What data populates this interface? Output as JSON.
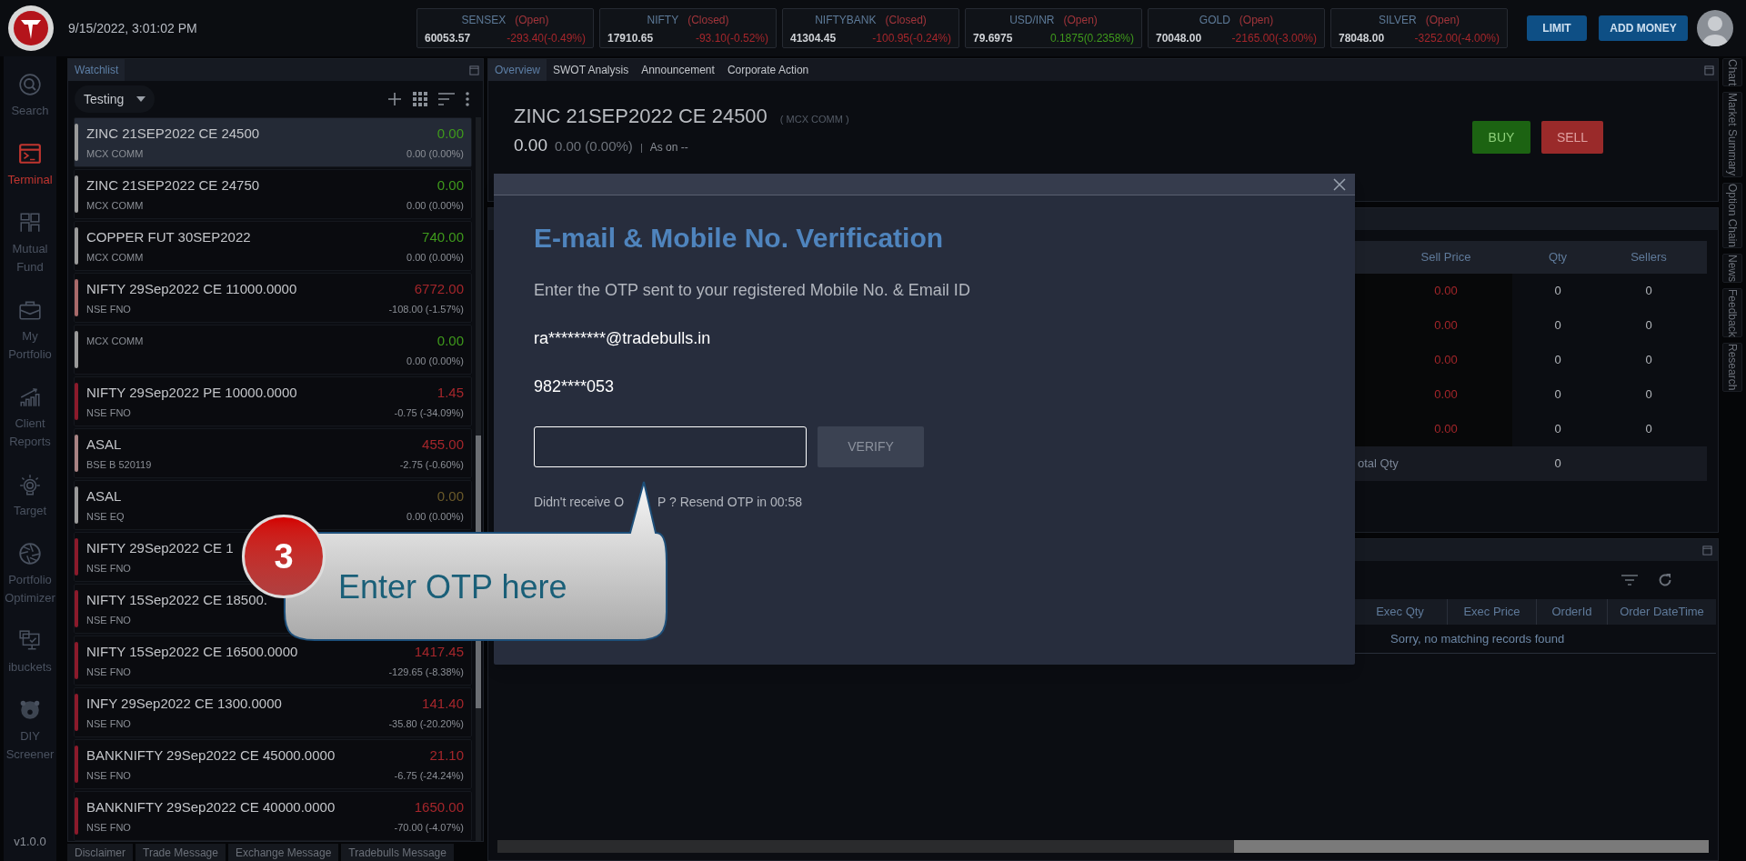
{
  "header": {
    "datetime": "9/15/2022, 3:01:02 PM",
    "tickers": [
      {
        "name": "SENSEX",
        "status": "(Open)",
        "value": "60053.57",
        "change": "-293.40(-0.49%)",
        "kind": "loss"
      },
      {
        "name": "NIFTY",
        "status": "(Closed)",
        "value": "17910.65",
        "change": "-93.10(-0.52%)",
        "kind": "loss"
      },
      {
        "name": "NIFTYBANK",
        "status": "(Closed)",
        "value": "41304.45",
        "change": "-100.95(-0.24%)",
        "kind": "loss"
      },
      {
        "name": "USD/INR",
        "status": "(Open)",
        "value": "79.6975",
        "change": "0.1875(0.2358%)",
        "kind": "gain"
      },
      {
        "name": "GOLD",
        "status": "(Open)",
        "value": "70048.00",
        "change": "-2165.00(-3.00%)",
        "kind": "loss"
      },
      {
        "name": "SILVER",
        "status": "(Open)",
        "value": "78048.00",
        "change": "-3252.00(-4.00%)",
        "kind": "loss"
      }
    ],
    "buttons": [
      "LIMIT",
      "ADD MONEY"
    ]
  },
  "sidebar": {
    "items": [
      {
        "label": "Search",
        "selected": false
      },
      {
        "label": "Terminal",
        "selected": true
      },
      {
        "label": "Mutual Fund",
        "selected": false
      },
      {
        "label": "My Portfolio",
        "selected": false
      },
      {
        "label": "Client Reports",
        "selected": false
      },
      {
        "label": "Target",
        "selected": false
      },
      {
        "label": "Portfolio Optimizer",
        "selected": false
      },
      {
        "label": "ibuckets",
        "selected": false
      },
      {
        "label": "DIY Screener",
        "selected": false
      }
    ],
    "version": "v1.0.0"
  },
  "watchlist": {
    "title": "Watchlist",
    "list_name": "Testing",
    "items": [
      {
        "name": "ZINC 21SEP2022 CE 24500",
        "exchange": "MCX COMM",
        "price": "0.00",
        "change": "0.00 (0.00%)",
        "kind": "gain",
        "color": "#9a9a9a",
        "selected": true
      },
      {
        "name": "ZINC 21SEP2022 CE 24750",
        "exchange": "MCX COMM",
        "price": "0.00",
        "change": "0.00 (0.00%)",
        "kind": "gain",
        "color": "#9a9a9a",
        "selected": false
      },
      {
        "name": "COPPER FUT 30SEP2022",
        "exchange": "MCX COMM",
        "price": "740.00",
        "change": "0.00 (0.00%)",
        "kind": "gain",
        "color": "#9a9a9a",
        "selected": false
      },
      {
        "name": "NIFTY 29Sep2022 CE 11000.0000",
        "exchange": "NSE FNO",
        "price": "6772.00",
        "change": "-108.00 (-1.57%)",
        "kind": "loss",
        "color": "#a86a6a",
        "selected": false
      },
      {
        "exchange": "MCX COMM",
        "price": "0.00",
        "change": "0.00 (0.00%)",
        "kind": "gain",
        "color": "#9a9a9a",
        "selected": false
      },
      {
        "name": "NIFTY 29Sep2022 PE 10000.0000",
        "exchange": "NSE FNO",
        "price": "1.45",
        "change": "-0.75 (-34.09%)",
        "kind": "loss",
        "color": "#8b1a2b",
        "selected": false
      },
      {
        "name": "ASAL",
        "exchange": "BSE B 520119",
        "price": "455.00",
        "change": "-2.75 (-0.60%)",
        "kind": "loss",
        "color": "#a88383",
        "selected": false
      },
      {
        "name": "ASAL",
        "exchange": "NSE EQ",
        "price": "0.00",
        "change": "0.00 (0.00%)",
        "kind": "flat",
        "color": "#9a9a9a",
        "selected": false
      },
      {
        "name": "NIFTY 29Sep2022 CE 1",
        "exchange": "NSE FNO",
        "color": "#8b1a2b",
        "selected": false
      },
      {
        "name": "NIFTY 15Sep2022 CE 18500.",
        "exchange": "NSE FNO",
        "color": "#8b1a2b",
        "selected": false
      },
      {
        "name": "NIFTY 15Sep2022 CE 16500.0000",
        "exchange": "NSE FNO",
        "price": "1417.45",
        "change": "-129.65 (-8.38%)",
        "kind": "loss",
        "color": "#8b1a2b",
        "selected": false
      },
      {
        "name": "INFY 29Sep2022 CE 1300.0000",
        "exchange": "NSE FNO",
        "price": "141.40",
        "change": "-35.80 (-20.20%)",
        "kind": "loss",
        "color": "#8b1a2b",
        "selected": false
      },
      {
        "name": "BANKNIFTY 29Sep2022 CE 45000.0000",
        "exchange": "NSE FNO",
        "price": "21.10",
        "change": "-6.75 (-24.24%)",
        "kind": "loss",
        "color": "#8b1a2b",
        "selected": false
      },
      {
        "name": "BANKNIFTY 29Sep2022 CE 40000.0000",
        "exchange": "NSE FNO",
        "price": "1650.00",
        "change": "-70.00 (-4.07%)",
        "kind": "loss",
        "color": "#8b1a2b",
        "selected": false
      }
    ],
    "footer_tabs": [
      "Disclaimer",
      "Trade Message",
      "Exchange Message",
      "Tradebulls Message"
    ]
  },
  "main_tabs": [
    {
      "label": "Overview",
      "selected": true
    },
    {
      "label": "SWOT Analysis",
      "selected": false
    },
    {
      "label": "Announcement",
      "selected": false
    },
    {
      "label": "Corporate Action",
      "selected": false
    }
  ],
  "overview": {
    "symbol": "ZINC 21SEP2022 CE 24500",
    "exchange": "( MCX COMM )",
    "price": "0.00",
    "change": "0.00 (0.00%)",
    "separator": "|",
    "as_on": "As on --",
    "buy": "BUY",
    "sell": "SELL"
  },
  "market_depth": {
    "columns": [
      "Sell Price",
      "Qty",
      "Sellers"
    ],
    "rows": [
      [
        "0.00",
        "0",
        "0"
      ],
      [
        "0.00",
        "0",
        "0"
      ],
      [
        "0.00",
        "0",
        "0"
      ],
      [
        "0.00",
        "0",
        "0"
      ],
      [
        "0.00",
        "0",
        "0"
      ]
    ],
    "total_label": "otal Qty",
    "total_qty": "0"
  },
  "orders": {
    "columns": [
      "Exec Qty",
      "Exec Price",
      "OrderId",
      "Order DateTime"
    ],
    "empty_message": "Sorry, no matching records found"
  },
  "side_tabs": [
    "Chart",
    "Market Summary",
    "Option Chain",
    "News",
    "Feedback",
    "Research"
  ],
  "modal": {
    "title": "E-mail & Mobile No. Verification",
    "instruction": "Enter the OTP sent to your registered Mobile No. & Email ID",
    "email": "ra*********@tradebulls.in",
    "mobile": "982****053",
    "verify": "VERIFY",
    "resend_start": "Didn't receive O",
    "resend_end": "P ? Resend OTP in 00:58"
  },
  "callout": {
    "step": "3",
    "text": "Enter OTP here"
  }
}
